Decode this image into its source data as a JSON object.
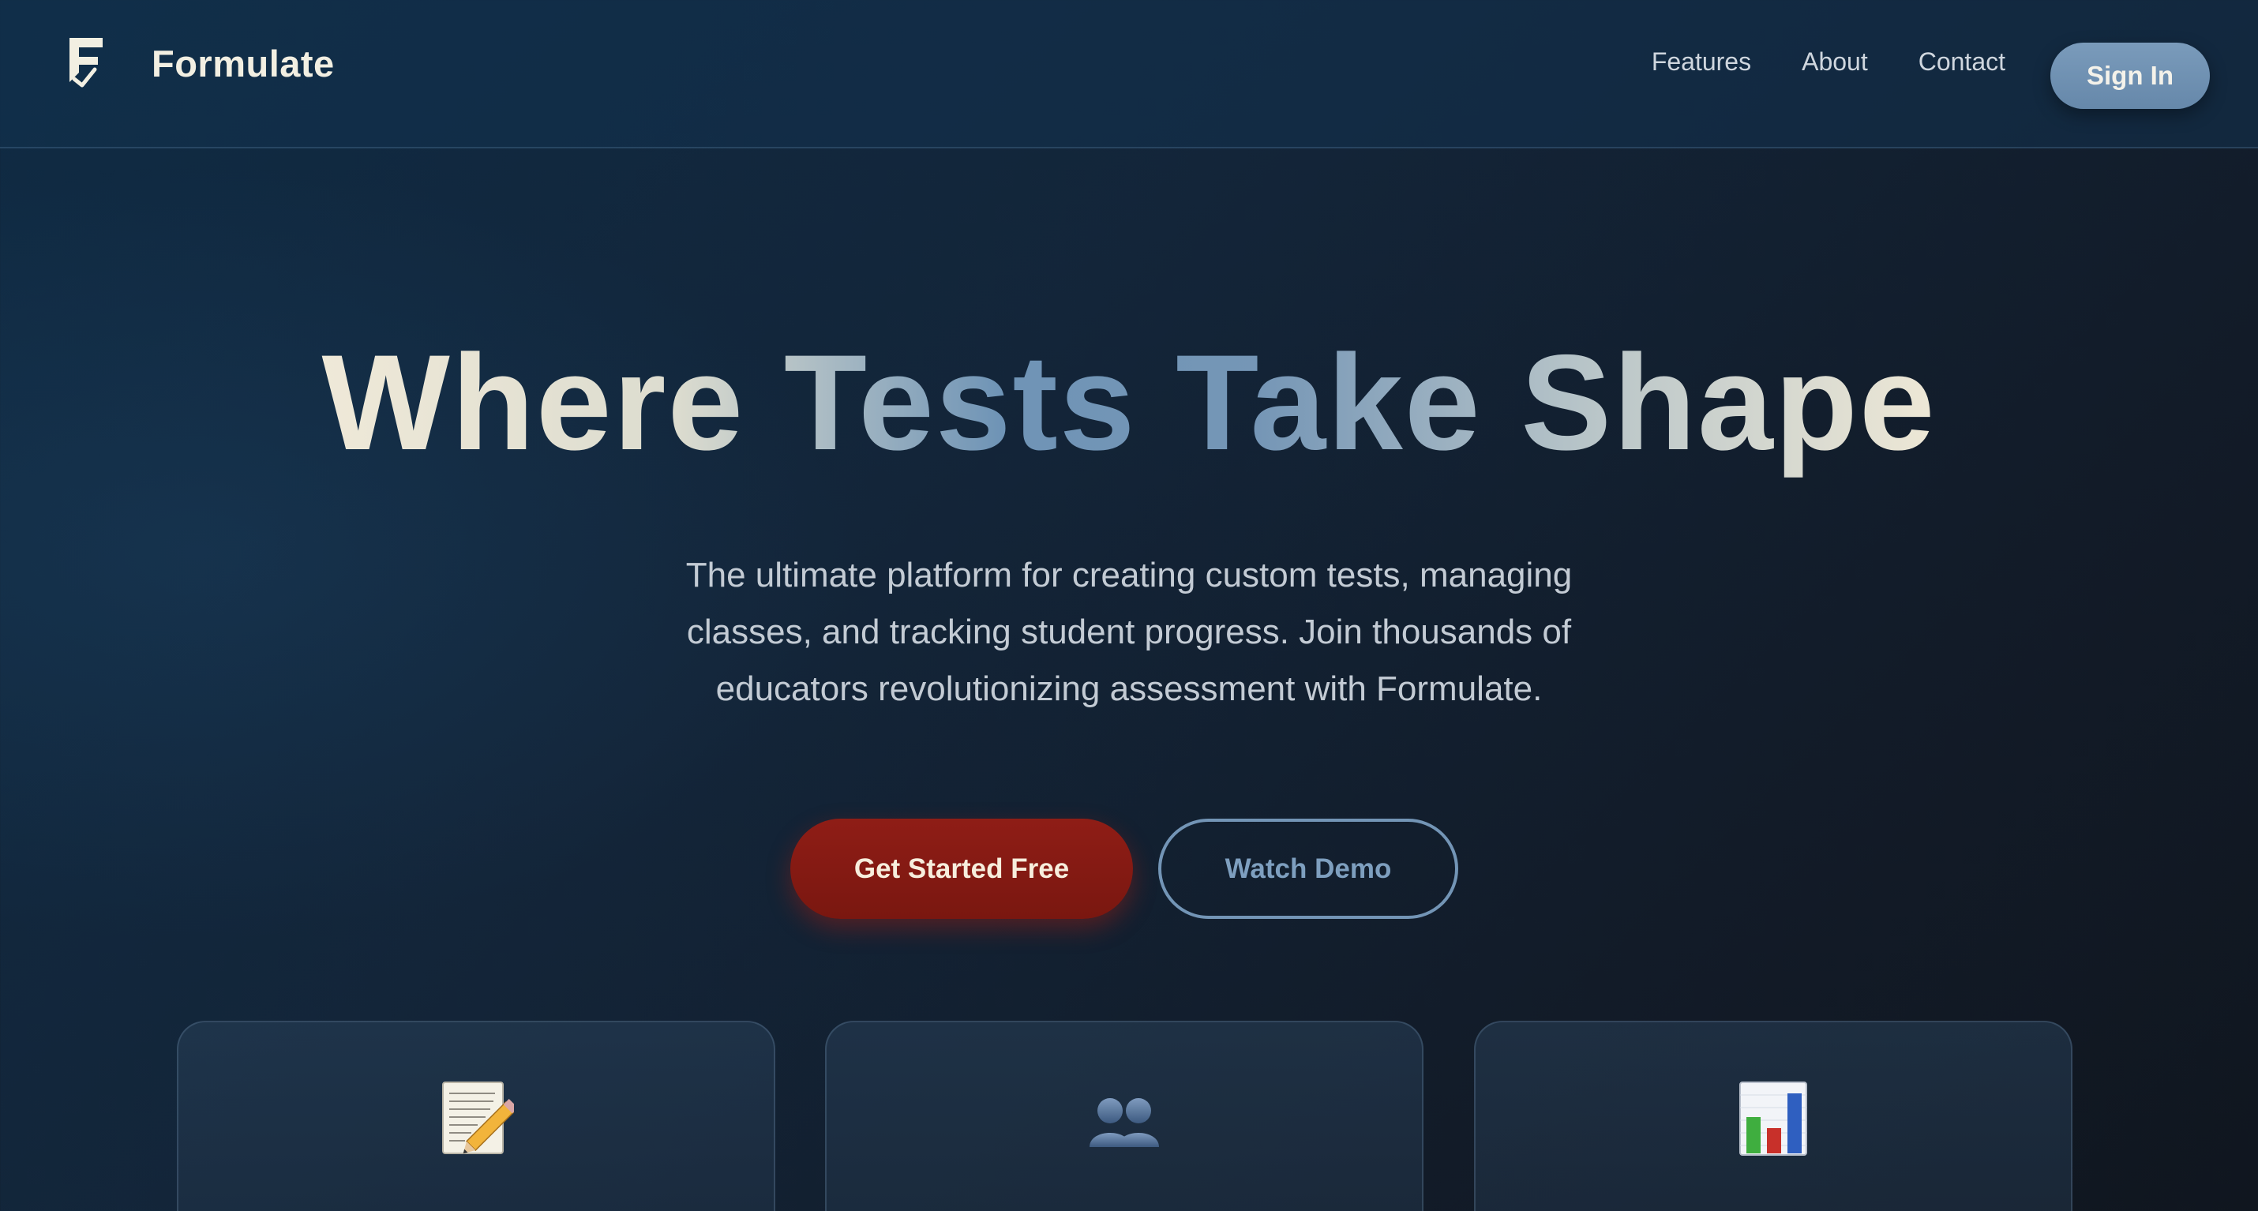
{
  "navbar": {
    "brand": "Formulate",
    "logo_icon": "formulate-logo-icon",
    "links": [
      {
        "label": "Features"
      },
      {
        "label": "About"
      },
      {
        "label": "Contact"
      }
    ],
    "signin_label": "Sign In"
  },
  "hero": {
    "title": "Where Tests Take Shape",
    "subtitle": "The ultimate platform for creating custom tests, managing classes, and tracking student progress. Join thousands of educators revolutionizing assessment with Formulate.",
    "primary_cta": "Get Started Free",
    "secondary_cta": "Watch Demo"
  },
  "features": [
    {
      "icon": "memo-pencil-icon"
    },
    {
      "icon": "users-icon"
    },
    {
      "icon": "bar-chart-icon"
    }
  ],
  "colors": {
    "accent_red": "#8f1d16",
    "accent_blue": "#7395b6",
    "cream": "#efe9d8",
    "background": "#132539"
  }
}
